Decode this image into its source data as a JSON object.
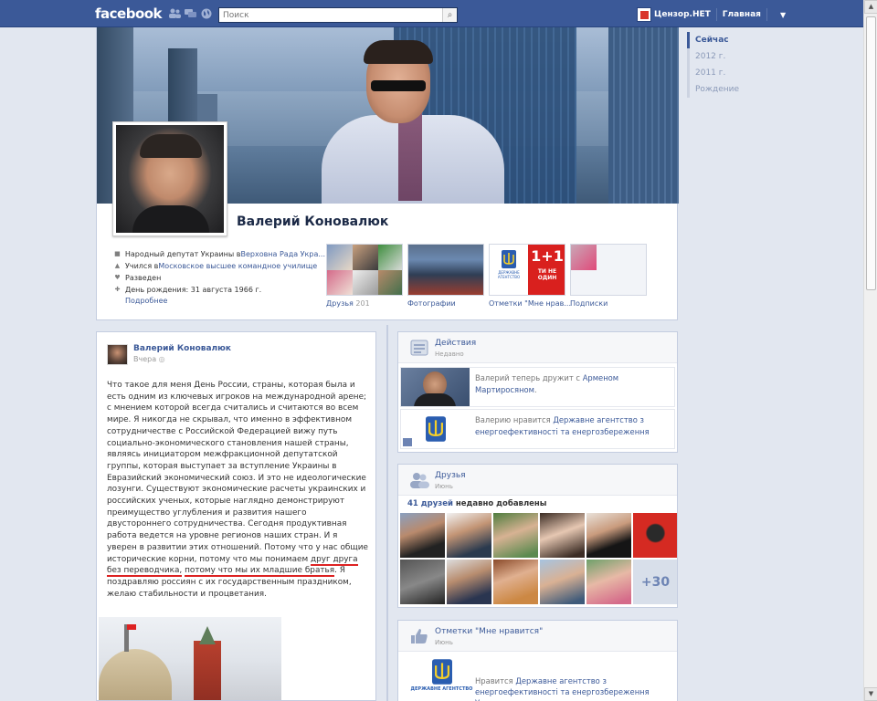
{
  "topbar": {
    "logo": "facebook",
    "search_placeholder": "Поиск",
    "user_name": "Цензор.НЕТ",
    "home_label": "Главная"
  },
  "timeline_nav": {
    "items": [
      "Сейчас",
      "2012 г.",
      "2011 г.",
      "Рождение"
    ]
  },
  "profile": {
    "name": "Валерий Коновалюк",
    "info": [
      {
        "icon": "briefcase-icon",
        "prefix": "Народный депутат Украины в ",
        "link": "Верховна Рада Укра..."
      },
      {
        "icon": "graduation-cap-icon",
        "prefix": "Учился в ",
        "link": "Московское высшее командное училище"
      },
      {
        "icon": "heart-icon",
        "prefix": "Разведен",
        "link": ""
      },
      {
        "icon": "gift-icon",
        "prefix": "День рождения: 31 августа 1966 г.",
        "link": ""
      }
    ],
    "more_label": "Подробнее",
    "tiles": [
      {
        "label": "Друзья",
        "count": "201"
      },
      {
        "label": "Фотографии",
        "count": ""
      },
      {
        "label": "Отметки \"Мне нрав...",
        "count": ""
      },
      {
        "label": "Подписки",
        "count": ""
      }
    ]
  },
  "post": {
    "author": "Валерий Коновалюк",
    "time": "Вчера",
    "text_before": "Что такое для меня День России, страны, которая была и есть одним из ключевых игроков на международной арене; с мнением которой всегда считались и считаются во всем мире. Я никогда не скрывал, что именно в эффективном сотрудничестве с Российской Федерацией вижу путь социально-экономического становления нашей страны, являясь инициатором межфракционной депутатской группы, которая выступает за вступление Украины в Евразийский экономический союз. И это не идеологические лозунги. Существуют экономические расчеты украинских и российских ученых, которые наглядно демонстрируют преимущество углубления и развития нашего двустороннего сотрудничества. Сегодня продуктивная работа ведется на уровне регионов наших стран. И я уверен в развитии этих отношений. Потому что у нас общие исторические корни, потому что мы понимаем ",
    "underlined_1": "друг друга без переводчика,",
    "text_mid": " ",
    "underlined_2": "потому что мы их младшие братья",
    "text_after": ". Я поздравляю россиян с их государственным праздником, желаю стабильности и процветания."
  },
  "activity": {
    "title": "Действия",
    "sub": "Недавно",
    "rows": [
      {
        "prefix": "Валерий теперь дружит с ",
        "link": "Арменом Мартиросяном",
        "suffix": "."
      },
      {
        "prefix": "Валерию нравится ",
        "link": "Державне агентство з енергоефективності та енергозбереження",
        "suffix": ""
      }
    ]
  },
  "friends": {
    "title": "Друзья",
    "sub": "Июнь",
    "count_link": "41 друзей",
    "count_suffix": " недавно добавлены",
    "more": "+30"
  },
  "likes": {
    "title": "Отметки \"Мне нравится\"",
    "sub": "Июнь",
    "logo_text": "ДЕРЖАВНЕ АГЕНТСТВО",
    "prefix": "Нравится ",
    "link": "Державне агентство з енергоефективності та енергозбереження Украин..."
  },
  "colors": {
    "brand": "#3b5998",
    "background": "#e2e7f0",
    "underline": "#dd2222"
  }
}
